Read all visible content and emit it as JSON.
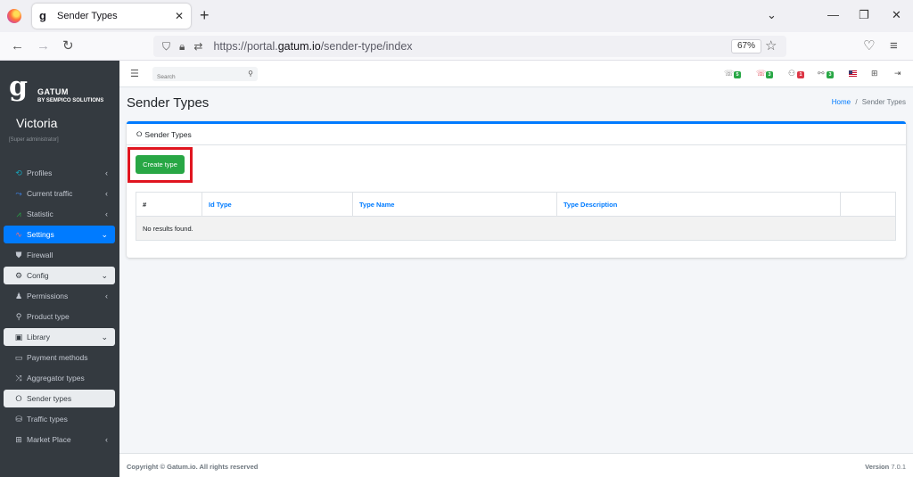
{
  "browser": {
    "tab_title": "Sender Types",
    "new_tab": "+",
    "url_scheme": "https://portal.",
    "url_domain": "gatum.io",
    "url_path": "/sender-type/index",
    "zoom": "67%"
  },
  "sidebar": {
    "brand_name": "GATUM",
    "brand_sub": "BY SEMPICO SOLUTIONS",
    "user_name": "Victoria",
    "user_role": "[Super administrator]",
    "items": [
      {
        "label": "Profiles",
        "icon": "profiles-icon"
      },
      {
        "label": "Current traffic",
        "icon": "traffic-icon"
      },
      {
        "label": "Statistic",
        "icon": "statistic-icon"
      },
      {
        "label": "Settings",
        "icon": "settings-icon"
      },
      {
        "label": "Firewall",
        "icon": "shield-icon"
      },
      {
        "label": "Config",
        "icon": "gear-icon"
      },
      {
        "label": "Permissions",
        "icon": "person-icon"
      },
      {
        "label": "Product type",
        "icon": "product-icon"
      },
      {
        "label": "Library",
        "icon": "book-icon"
      },
      {
        "label": "Payment methods",
        "icon": "card-icon"
      },
      {
        "label": "Aggregator types",
        "icon": "aggregator-icon"
      },
      {
        "label": "Sender types",
        "icon": "circle-icon"
      },
      {
        "label": "Traffic types",
        "icon": "database-icon"
      },
      {
        "label": "Market Place",
        "icon": "grid-icon"
      }
    ]
  },
  "header": {
    "search_placeholder": "Search",
    "badges": [
      {
        "value": "5",
        "color": "#28a745"
      },
      {
        "value": "3",
        "color": "#28a745"
      },
      {
        "value": "1",
        "color": "#dc3545"
      },
      {
        "value": "3",
        "color": "#28a745"
      }
    ]
  },
  "page": {
    "title": "Sender Types",
    "breadcrumb_home": "Home",
    "breadcrumb_sep": "/",
    "breadcrumb_current": "Sender Types",
    "card_title": "Sender Types",
    "create_button": "Create type",
    "table": {
      "columns": [
        "#",
        "Id Type",
        "Type Name",
        "Type Description",
        ""
      ],
      "empty_message": "No results found."
    }
  },
  "footer": {
    "copyright": "Copyright © Gatum.io. All rights reserved",
    "version_label": "Version",
    "version_value": "7.0.1"
  }
}
